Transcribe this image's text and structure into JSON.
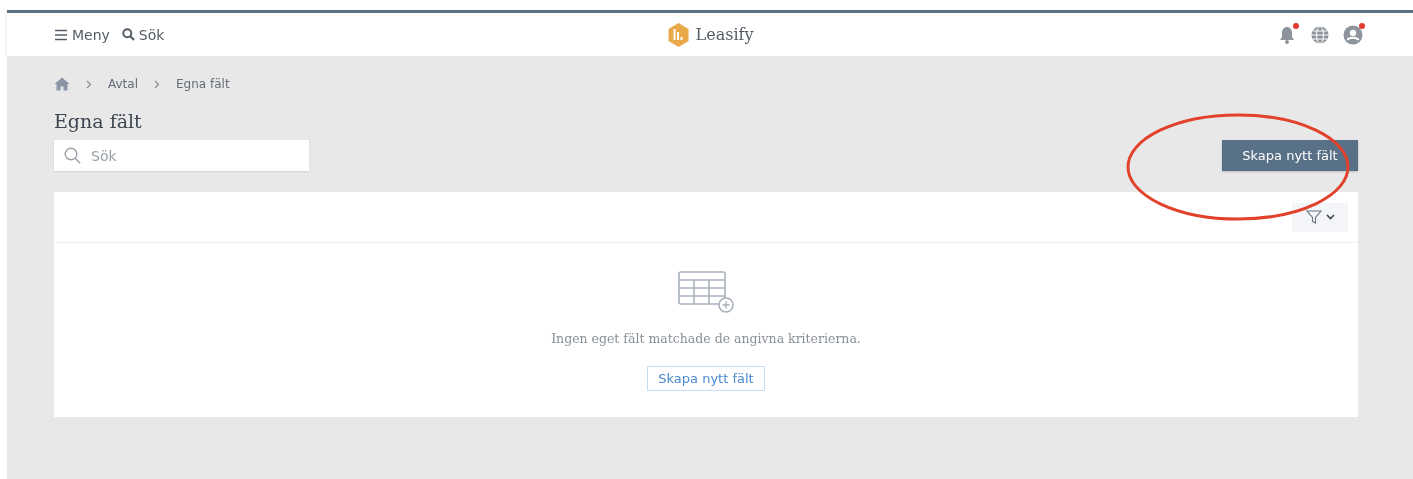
{
  "header": {
    "menu_label": "Meny",
    "search_label": "Sök",
    "logo_text": "Leasify",
    "icons": [
      {
        "kind": "bell",
        "badge": true
      },
      {
        "kind": "globe",
        "badge": false
      },
      {
        "kind": "user",
        "badge": true
      }
    ]
  },
  "breadcrumb": [
    "Avtal",
    "Egna fält"
  ],
  "title": "Egna fält",
  "search": {
    "placeholder": "Sök"
  },
  "primary_button": "Skapa nytt fält",
  "empty_state": {
    "message": "Ingen eget fält matchade de angivna kriterierna.",
    "button": "Skapa nytt fält"
  }
}
